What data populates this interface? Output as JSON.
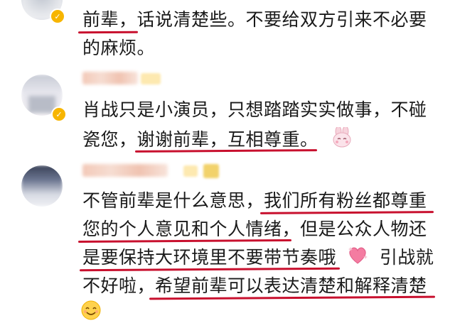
{
  "comments": [
    {
      "lines": [
        "前辈，话说清楚些。不要给双方引来不必要",
        "的麻烦。"
      ],
      "underlined": [
        "前辈，"
      ]
    },
    {
      "lines": [
        "肖战只是小演员，只想踏踏实实做事，不碰",
        "瓷您，谢谢前辈，互相尊重。"
      ],
      "underlined": [
        "谢谢前辈，互相尊重。"
      ],
      "emoji": "bunny-face-emoji"
    },
    {
      "lines": [
        "不管前辈是什么意思，我们所有粉丝都尊重",
        "您的个人意见和个人情绪，但是公众人物还",
        "是要保持大环境里不要带节奏哦",
        "引战就",
        "不好啦，希望前辈可以表达清楚和解释清楚"
      ],
      "underlined": [
        "我们所有粉丝都尊重",
        "您的个人意见和个人情绪，",
        "是要保持大环境里不要带节奏哦",
        "希望前辈可以表达清楚和解释清楚"
      ],
      "emoji": "sparkle-heart-emoji",
      "emoji_end": "smile-emoji"
    }
  ],
  "colors": {
    "underline": "#c8102e",
    "text": "#1a1a1a",
    "vip_badge": "#f7b500"
  }
}
